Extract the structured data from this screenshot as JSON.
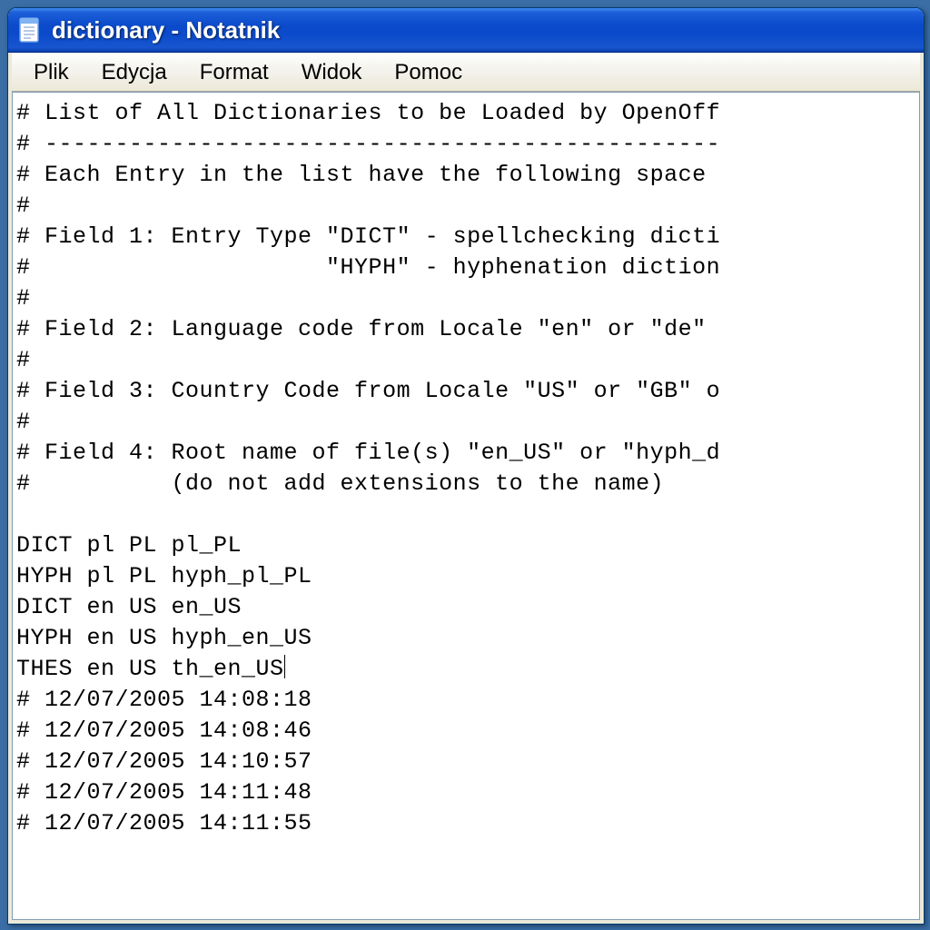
{
  "window": {
    "title": "dictionary - Notatnik",
    "icon": "notepad-icon"
  },
  "menubar": {
    "items": [
      {
        "label": "Plik"
      },
      {
        "label": "Edycja"
      },
      {
        "label": "Format"
      },
      {
        "label": "Widok"
      },
      {
        "label": "Pomoc"
      }
    ]
  },
  "editor": {
    "lines": [
      "# List of All Dictionaries to be Loaded by OpenOff",
      "# ------------------------------------------------",
      "# Each Entry in the list have the following space ",
      "#",
      "# Field 1: Entry Type \"DICT\" - spellchecking dicti",
      "#                     \"HYPH\" - hyphenation diction",
      "#",
      "# Field 2: Language code from Locale \"en\" or \"de\" ",
      "#",
      "# Field 3: Country Code from Locale \"US\" or \"GB\" o",
      "#",
      "# Field 4: Root name of file(s) \"en_US\" or \"hyph_d",
      "#          (do not add extensions to the name)",
      "",
      "DICT pl PL pl_PL",
      "HYPH pl PL hyph_pl_PL",
      "DICT en US en_US",
      "HYPH en US hyph_en_US",
      "THES en US th_en_US",
      "# 12/07/2005 14:08:18",
      "# 12/07/2005 14:08:46",
      "# 12/07/2005 14:10:57",
      "# 12/07/2005 14:11:48",
      "# 12/07/2005 14:11:55"
    ],
    "caret_line": 18,
    "caret_col_end": true
  }
}
